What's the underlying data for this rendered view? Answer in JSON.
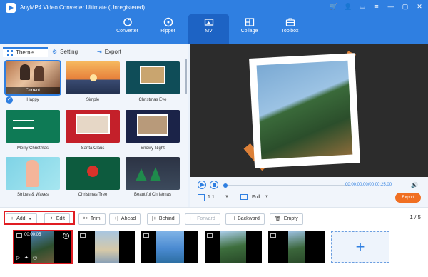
{
  "app": {
    "title": "AnyMP4 Video Converter Ultimate (Unregistered)"
  },
  "nav": {
    "tabs": [
      {
        "label": "Converter",
        "icon": "converter-icon"
      },
      {
        "label": "Ripper",
        "icon": "ripper-icon"
      },
      {
        "label": "MV",
        "icon": "mv-icon",
        "active": true
      },
      {
        "label": "Collage",
        "icon": "collage-icon"
      },
      {
        "label": "Toolbox",
        "icon": "toolbox-icon"
      }
    ]
  },
  "subtabs": [
    {
      "label": "Theme",
      "active": true
    },
    {
      "label": "Setting"
    },
    {
      "label": "Export"
    }
  ],
  "themes": [
    {
      "label": "Happy",
      "badge": "Current",
      "selected": true
    },
    {
      "label": "Simple"
    },
    {
      "label": "Christmas Eve"
    },
    {
      "label": "Merry Christmas"
    },
    {
      "label": "Santa Claus"
    },
    {
      "label": "Snowy Night"
    },
    {
      "label": "Stripes & Waves"
    },
    {
      "label": "Christmas Tree"
    },
    {
      "label": "Beautiful Christmas"
    }
  ],
  "player": {
    "time": "00:00:00.00/00:00:25.00",
    "ratio": "1:1",
    "view": "Full",
    "export_label": "Export"
  },
  "toolbar": {
    "add": "Add",
    "edit": "Edit",
    "trim": "Trim",
    "ahead": "Ahead",
    "behind": "Behind",
    "forward": "Forward",
    "backward": "Backward",
    "empty": "Empty",
    "page": "1 / 5"
  },
  "clips": [
    {
      "duration": "00:00:05",
      "selected": true
    },
    {},
    {},
    {},
    {}
  ],
  "colors": {
    "accent": "#2f7fe1",
    "export": "#f06f22",
    "highlight": "#e01d23"
  }
}
